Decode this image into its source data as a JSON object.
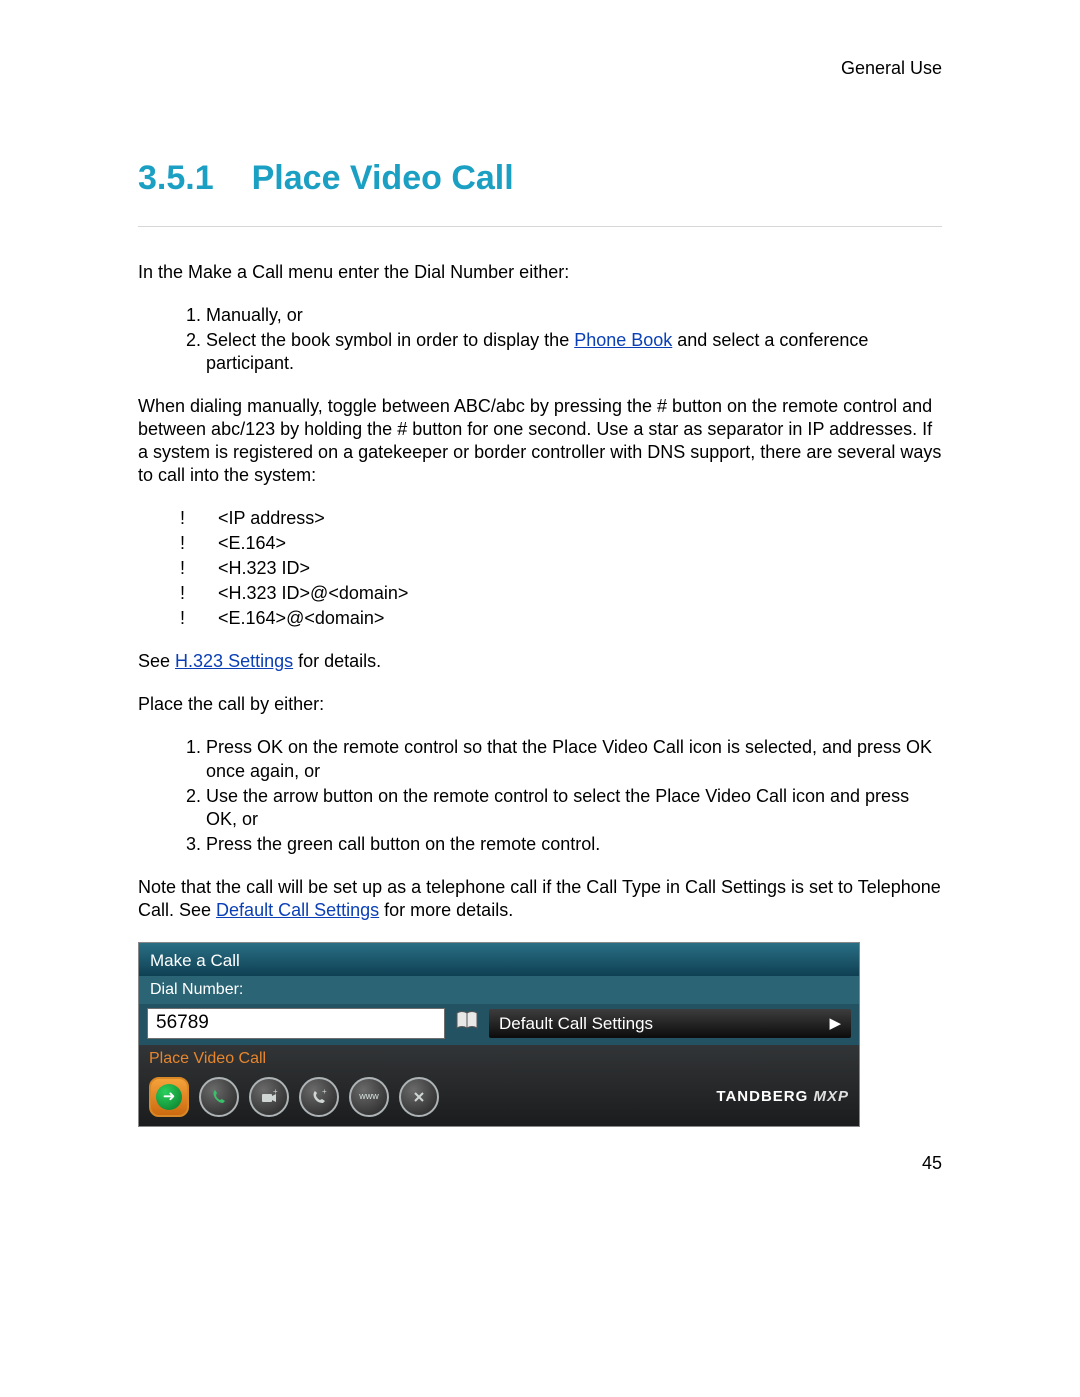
{
  "header": {
    "section": "General Use"
  },
  "heading": {
    "number": "3.5.1",
    "title": "Place Video Call"
  },
  "intro": "In the Make a Call menu enter the Dial Number either:",
  "entry_list": [
    "Manually, or",
    {
      "pre": "Select the book symbol in order to display the ",
      "link": "Phone Book",
      "post": " and select a conference participant."
    }
  ],
  "manual_para": "When dialing manually, toggle between ABC/abc by pressing the # button on the remote control and between abc/123 by holding the # button for one second. Use a star as separator in IP addresses. If a system is registered on a gatekeeper or border controller with DNS support, there are several ways to call into the system:",
  "call_methods": [
    "<IP address>",
    "<E.164>",
    "<H.323 ID>",
    "<H.323 ID>@<domain>",
    "<E.164>@<domain>"
  ],
  "see_settings": {
    "pre": "See ",
    "link": "H.323 Settings",
    "post": " for details."
  },
  "place_intro": "Place the call by either:",
  "place_list": [
    "Press OK on the remote control so that the Place Video Call icon is selected, and press OK once again, or",
    "Use the arrow button on the remote control to select the Place Video Call icon and press OK, or",
    "Press the green call button on the remote control."
  ],
  "note": {
    "pre": "Note that the call will be set up as a telephone call if the Call Type in Call Settings is set to Telephone Call. See ",
    "link": "Default Call Settings",
    "post": " for more details."
  },
  "ui": {
    "title": "Make a Call",
    "dial_label": "Dial Number:",
    "dial_value": "56789",
    "settings_button": "Default Call Settings",
    "place_label": "Place Video Call",
    "brand": "TANDBERG",
    "brand_suffix": "MXP",
    "icons": {
      "video_call": "video-call-icon",
      "audio_call": "audio-call-icon",
      "add_video": "add-video-icon",
      "add_audio": "add-audio-icon",
      "streaming": "streaming-icon",
      "close": "close-icon"
    }
  },
  "page_number": "45"
}
